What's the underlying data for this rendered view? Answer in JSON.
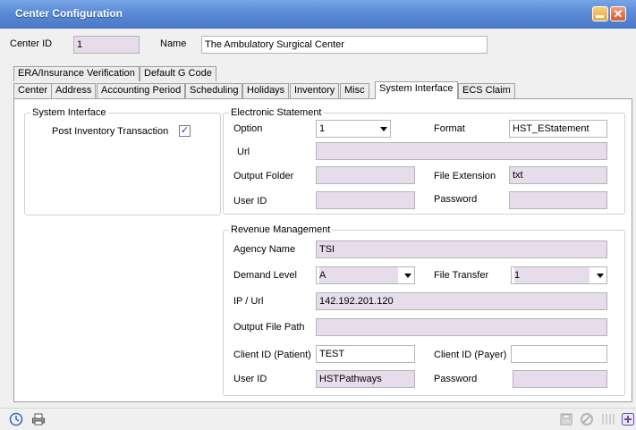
{
  "window": {
    "title": "Center Configuration"
  },
  "header": {
    "center_id_label": "Center ID",
    "center_id_value": "1",
    "name_label": "Name",
    "name_value": "The Ambulatory Surgical  Center"
  },
  "tabs_row1": [
    "ERA/Insurance Verification",
    "Default G Code"
  ],
  "tabs_row2": [
    "Center",
    "Address",
    "Accounting Period",
    "Scheduling",
    "Holidays",
    "Inventory",
    "Misc",
    "System Interface",
    "ECS Claim"
  ],
  "active_tab": "System Interface",
  "system_interface": {
    "group_label": "System Interface",
    "post_inventory_label": "Post Inventory Transaction",
    "post_inventory_checked": true
  },
  "electronic_statement": {
    "group_label": "Electronic Statement",
    "option_label": "Option",
    "option_value": "1",
    "format_label": "Format",
    "format_value": "HST_EStatement",
    "url_label": "Url",
    "url_value": "",
    "output_folder_label": "Output Folder",
    "output_folder_value": "",
    "file_extension_label": "File Extension",
    "file_extension_value": "txt",
    "user_id_label": "User ID",
    "user_id_value": "",
    "password_label": "Password",
    "password_value": ""
  },
  "revenue_management": {
    "group_label": "Revenue Management",
    "agency_name_label": "Agency Name",
    "agency_name_value": "TSI",
    "demand_level_label": "Demand Level",
    "demand_level_value": "A",
    "file_transfer_label": "File Transfer",
    "file_transfer_value": "1",
    "ip_url_label": "IP / Url",
    "ip_url_value": "142.192.201.120",
    "output_file_path_label": "Output File Path",
    "output_file_path_value": "",
    "client_id_patient_label": "Client ID (Patient)",
    "client_id_patient_value": "TEST",
    "client_id_payer_label": "Client ID (Payer)",
    "client_id_payer_value": "",
    "user_id_label": "User ID",
    "user_id_value": "HSTPathways",
    "password_label": "Password",
    "password_value": ""
  },
  "statusbar": {
    "icons": [
      "clock-icon",
      "printer-icon",
      "save-icon",
      "cancel-icon",
      "grip-icon",
      "add-icon"
    ]
  }
}
